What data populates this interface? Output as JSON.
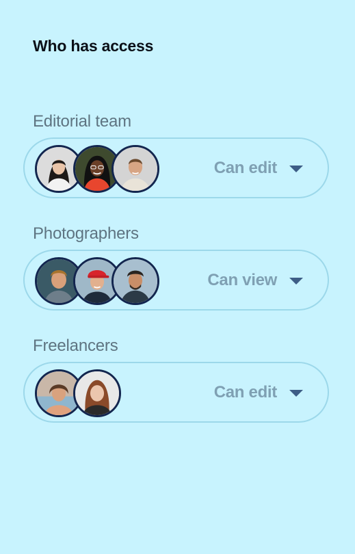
{
  "header": {
    "title": "Who has access"
  },
  "groups": [
    {
      "label": "Editorial team",
      "permission": "Can edit",
      "avatars": [
        "person-avatar",
        "person-avatar",
        "person-avatar"
      ]
    },
    {
      "label": "Photographers",
      "permission": "Can view",
      "avatars": [
        "person-avatar",
        "person-avatar",
        "person-avatar"
      ]
    },
    {
      "label": "Freelancers",
      "permission": "Can edit",
      "avatars": [
        "person-avatar",
        "person-avatar"
      ]
    }
  ],
  "colors": {
    "background": "#C8F3FE",
    "pill_border": "#9CD8EA",
    "avatar_ring": "#13264F",
    "permission_text": "#7FA0B3",
    "caret": "#3D5D86",
    "label_text": "#5E7481",
    "title_text": "#0B1018"
  },
  "icons": {
    "dropdown": "chevron-down-icon"
  }
}
